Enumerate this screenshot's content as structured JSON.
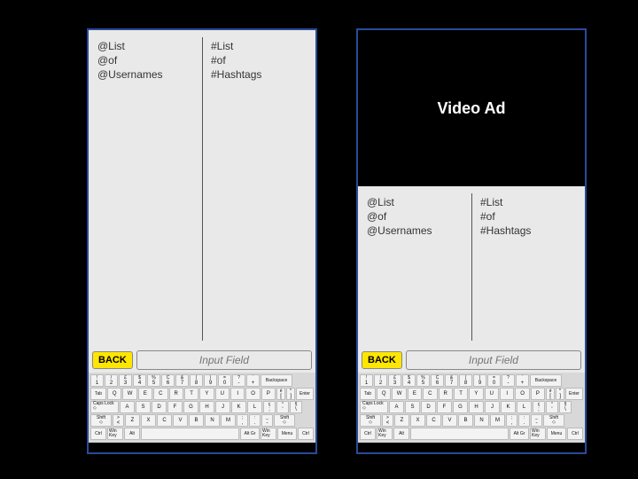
{
  "mockups": {
    "left": {
      "usernames": [
        "@List",
        "@of",
        "@Usernames"
      ],
      "hashtags": [
        "#List",
        "#of",
        "#Hashtags"
      ],
      "back_label": "BACK",
      "input_placeholder": "Input Field"
    },
    "right": {
      "video_ad_label": "Video Ad",
      "usernames": [
        "@List",
        "@of",
        "@Usernames"
      ],
      "hashtags": [
        "#List",
        "#of",
        "#Hashtags"
      ],
      "back_label": "BACK",
      "input_placeholder": "Input Field"
    }
  },
  "keyboard": {
    "row1": [
      {
        "top": "!",
        "bot": "1"
      },
      {
        "top": "/",
        "bot": "2"
      },
      {
        "top": "£",
        "bot": "3"
      },
      {
        "top": "$",
        "bot": "4"
      },
      {
        "top": "%",
        "bot": "5"
      },
      {
        "top": "C",
        "bot": "6"
      },
      {
        "top": "&",
        "bot": "7"
      },
      {
        "top": "(",
        "bot": "8"
      },
      {
        "top": ")",
        "bot": "9"
      },
      {
        "top": "=",
        "bot": "0"
      },
      {
        "top": "?",
        "bot": "-"
      },
      {
        "top": "`",
        "bot": "+"
      }
    ],
    "row1_backspace": "Backspace",
    "row2_tab": "Tab",
    "row2": [
      "Q",
      "W",
      "E",
      "C",
      "R",
      "T",
      "Y",
      "U",
      "I",
      "O",
      "P"
    ],
    "row2_brackets": [
      {
        "top": "é",
        "bot": "["
      },
      {
        "top": "*",
        "bot": "]"
      }
    ],
    "row2_enter": "Enter",
    "row3_caps": "Caps Lock",
    "row3": [
      "A",
      "S",
      "D",
      "F",
      "G",
      "H",
      "J",
      "K",
      "L"
    ],
    "row3_right": [
      {
        "top": "ç",
        "bot": ";"
      },
      {
        "top": "°",
        "bot": "'"
      },
      {
        "top": "§",
        "bot": "\\"
      }
    ],
    "row4_shift": "Shift",
    "row4_angle": {
      "top": ">",
      "bot": "<"
    },
    "row4": [
      "Z",
      "X",
      "C",
      "V",
      "B",
      "N",
      "M"
    ],
    "row4_punct": [
      {
        "top": ";",
        "bot": ","
      },
      {
        "top": ":",
        "bot": "."
      },
      {
        "top": "_",
        "bot": "-"
      }
    ],
    "row4_shiftr": "Shift",
    "row5": {
      "ctrl": "Ctrl",
      "win": "Win Key",
      "alt": "Alt",
      "altgr": "Alt Gr",
      "winr": "Win Key",
      "menu": "Menu",
      "ctrlr": "Ctrl"
    }
  }
}
